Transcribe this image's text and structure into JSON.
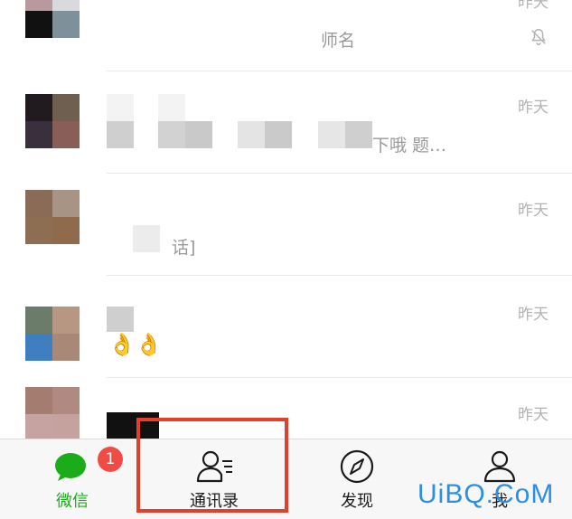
{
  "chats": [
    {
      "time": "昨天",
      "preview": "师名",
      "muted": true
    },
    {
      "time": "昨天",
      "preview": "下哦 题…"
    },
    {
      "time": "昨天",
      "preview": "话]"
    },
    {
      "time": "昨天",
      "preview": "👌👌"
    },
    {
      "time": "昨天",
      "preview": ""
    }
  ],
  "tabbar": {
    "chats": {
      "label": "微信",
      "badge": "1",
      "icon": "chat-bubble-icon"
    },
    "contacts": {
      "label": "通讯录",
      "icon": "contacts-icon"
    },
    "discover": {
      "label": "发现",
      "icon": "compass-icon"
    },
    "me": {
      "label": "我",
      "icon": "person-icon"
    }
  },
  "watermark": "UiBQ.CoM",
  "colors": {
    "active": "#1aad19",
    "badge": "#f04b45",
    "highlight": "#e2402b",
    "watermark": "#2e8ee2"
  }
}
